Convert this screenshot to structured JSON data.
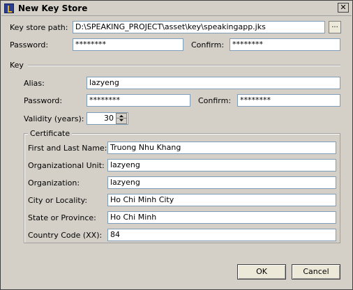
{
  "window": {
    "title": "New Key Store",
    "close_label": "✕"
  },
  "keystore": {
    "path_label": "Key store path:",
    "path_value": "D:\\SPEAKING_PROJECT\\asset\\key\\speakingapp.jks",
    "browse_label": "...",
    "password_label": "Password:",
    "password_value": "********",
    "confirm_label": "Confirm:",
    "confirm_value": "********"
  },
  "key": {
    "section_label": "Key",
    "alias_label": "Alias:",
    "alias_value": "lazyeng",
    "password_label": "Password:",
    "password_value": "********",
    "confirm_label": "Confirm:",
    "confirm_value": "********",
    "validity_label": "Validity (years):",
    "validity_value": "30"
  },
  "certificate": {
    "group_label": "Certificate",
    "fields": [
      {
        "label": "First and Last Name:",
        "value": "Truong Nhu Khang"
      },
      {
        "label": "Organizational Unit:",
        "value": "lazyeng"
      },
      {
        "label": "Organization:",
        "value": "lazyeng"
      },
      {
        "label": "City or Locality:",
        "value": "Ho Chi Minh City"
      },
      {
        "label": "State or Province:",
        "value": "Ho Chi Minh"
      },
      {
        "label": "Country Code (XX):",
        "value": "84"
      }
    ]
  },
  "buttons": {
    "ok": "OK",
    "cancel": "Cancel"
  }
}
